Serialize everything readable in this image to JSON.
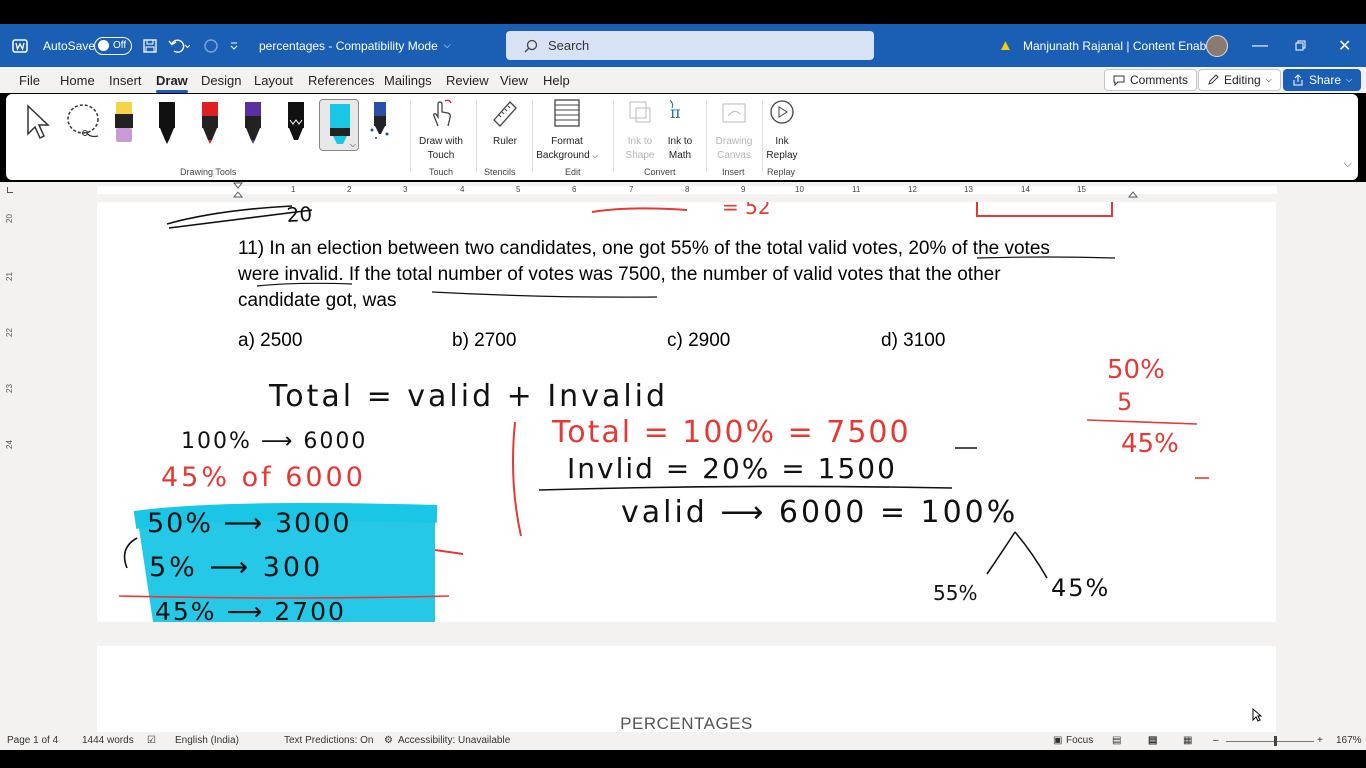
{
  "titlebar": {
    "autosave_label": "AutoSave",
    "autosave_state": "Off",
    "doc_title": "percentages - Compatibility Mode",
    "search_placeholder": "Search",
    "user_name": "Manjunath Rajanal | Content Enablers",
    "accent": "#1b5fb4"
  },
  "menu": {
    "items": [
      "File",
      "Home",
      "Insert",
      "Draw",
      "Design",
      "Layout",
      "References",
      "Mailings",
      "Review",
      "View",
      "Help"
    ],
    "active": "Draw",
    "comments_label": "Comments",
    "editing_label": "Editing",
    "share_label": "Share"
  },
  "ribbon": {
    "groups": {
      "drawing_tools": "Drawing Tools",
      "touch": "Touch",
      "stencils": "Stencils",
      "edit": "Edit",
      "convert": "Convert",
      "insert": "Insert",
      "replay": "Replay"
    },
    "buttons": {
      "draw_with_touch_1": "Draw with",
      "draw_with_touch_2": "Touch",
      "ruler": "Ruler",
      "format_bg_1": "Format",
      "format_bg_2": "Background",
      "ink_to_shape_1": "Ink to",
      "ink_to_shape_2": "Shape",
      "ink_to_math_1": "Ink to",
      "ink_to_math_2": "Math",
      "drawing_canvas_1": "Drawing",
      "drawing_canvas_2": "Canvas",
      "ink_replay_1": "Ink",
      "ink_replay_2": "Replay"
    },
    "pen_colors": [
      "#f5d547",
      "#111111",
      "#e02020",
      "#5a2fa0",
      "#111111",
      "#19c6e6",
      "#2a4fa8"
    ]
  },
  "ruler": {
    "numbers": [
      "1",
      "2",
      "3",
      "4",
      "5",
      "6",
      "7",
      "8",
      "9",
      "10",
      "11",
      "12",
      "13",
      "14",
      "15"
    ]
  },
  "vruler": {
    "numbers": [
      "20",
      "21",
      "22",
      "23",
      "24"
    ]
  },
  "document": {
    "question_line1": "11) In an election between two candidates, one got 55% of the total valid votes, 20% of the votes",
    "question_line2": "were invalid. If the total number of votes was 7500, the number of valid votes that the other",
    "question_line3": "candidate got, was",
    "options": [
      "a) 2500",
      "b) 2700",
      "c) 2900",
      "d) 3100"
    ],
    "page2_heading": "PERCENTAGES",
    "ink": {
      "top_left_partial": "20",
      "top_mid_partial": "= 52",
      "formula": "Total = valid + Invalid",
      "line_100": "100% ⟶ 6000",
      "line_45_of": "45% of 6000",
      "red_total": "Total = 100% = 7500",
      "red_invalid": "Invlid = 20% = 1500",
      "valid_line": "valid ⟶ 6000 = 100%",
      "split_55": "55%",
      "split_45": "45%",
      "hl_50": "50% ⟶ 3000",
      "hl_5": "5% ⟶ 300",
      "hl_45": "45% ⟶ 2700",
      "right_50": "50%",
      "right_5": "5",
      "right_45": "45%",
      "highlight_color": "#19c6e6",
      "red_ink": "#e53935"
    }
  },
  "status": {
    "page": "Page 1 of 4",
    "words": "1444 words",
    "language": "English (India)",
    "predictions": "Text Predictions: On",
    "accessibility": "Accessibility: Unavailable",
    "focus": "Focus",
    "zoom": "167%"
  }
}
